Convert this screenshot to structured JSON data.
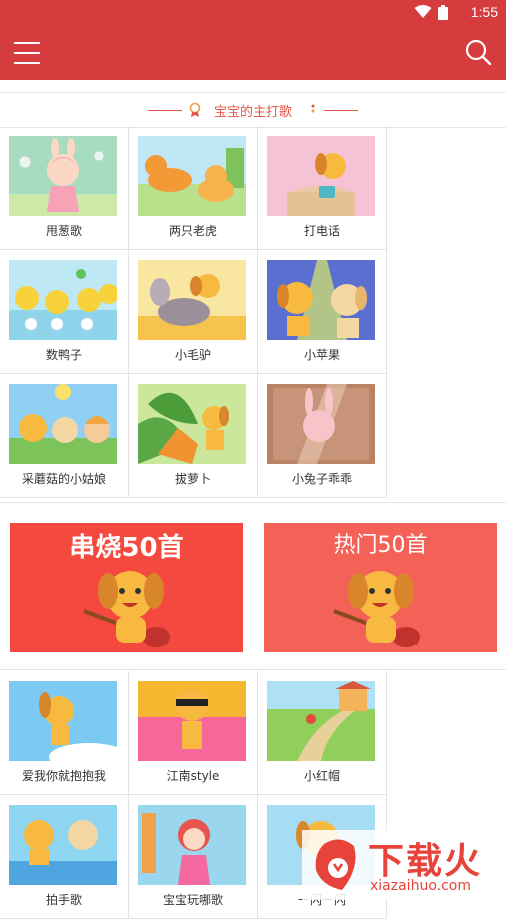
{
  "status": {
    "time": "1:55"
  },
  "app": {
    "menu_icon": "hamburger-menu-icon",
    "search_icon": "search-icon",
    "accent_color": "#d63b3d"
  },
  "section": {
    "title": "宝宝的主打歌"
  },
  "songs_top": [
    {
      "label": "甩葱歌"
    },
    {
      "label": "两只老虎"
    },
    {
      "label": "打电话"
    },
    {
      "label": "数鸭子"
    },
    {
      "label": "小毛驴"
    },
    {
      "label": "小苹果"
    },
    {
      "label": "采蘑菇的小姑娘"
    },
    {
      "label": "拔萝卜"
    },
    {
      "label": "小兔子乖乖"
    }
  ],
  "banners": [
    {
      "label": "串烧50首",
      "color": "#f4493f"
    },
    {
      "label": "热门50首",
      "color": "#f36157"
    }
  ],
  "songs_bottom": [
    {
      "label": "爱我你就抱抱我"
    },
    {
      "label": "江南style"
    },
    {
      "label": "小红帽"
    },
    {
      "label": "拍手歌"
    },
    {
      "label": "宝宝玩哪歌"
    },
    {
      "label": "一闪一闪"
    }
  ],
  "watermark": {
    "brand": "下载火",
    "domain": "xiazaihuo.com"
  }
}
